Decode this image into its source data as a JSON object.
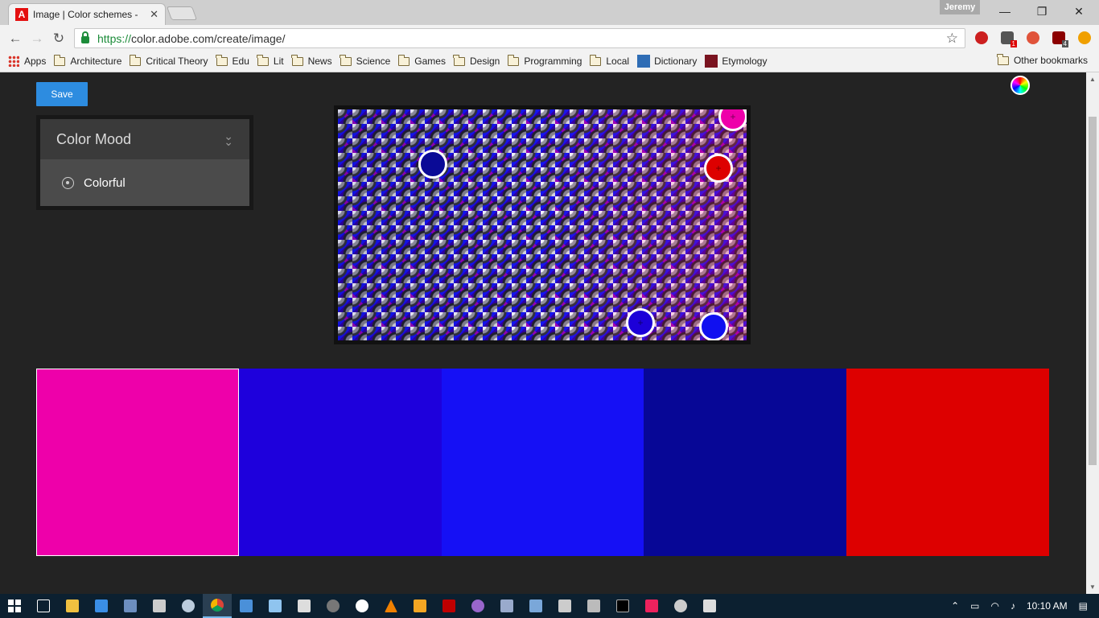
{
  "window": {
    "tab_title": "Image | Color schemes -",
    "tab_close": "✕",
    "profile_name": "Jeremy",
    "controls": {
      "minimize": "—",
      "restore": "❐",
      "close": "✕"
    }
  },
  "toolbar": {
    "back": "←",
    "forward": "→",
    "reload": "↻",
    "url_scheme": "https://",
    "url_rest": "color.adobe.com/create/image/",
    "star": "☆",
    "ext_badges": {
      "ext2": "1",
      "ext4": "4"
    }
  },
  "bookmarks": {
    "apps": "Apps",
    "folders": [
      "Architecture",
      "Critical Theory",
      "Edu",
      "Lit",
      "News",
      "Science",
      "Games",
      "Design",
      "Programming",
      "Local"
    ],
    "dictionary": "Dictionary",
    "etymology": "Etymology",
    "other": "Other bookmarks"
  },
  "page": {
    "save_label": "Save",
    "color_mood": {
      "title": "Color Mood",
      "selected": "Colorful"
    },
    "pickers": [
      {
        "color": "#ee00aa",
        "icon": "+"
      },
      {
        "color": "#0a0a96",
        "icon": ""
      },
      {
        "color": "#dd0000",
        "icon": "+"
      },
      {
        "color": "#1c00d8",
        "icon": "+"
      },
      {
        "color": "#1010f0",
        "icon": ""
      }
    ],
    "swatches": [
      "#ee00aa",
      "#1e00dc",
      "#1510f5",
      "#070796",
      "#dd0000"
    ],
    "active_swatch": 0
  },
  "taskbar": {
    "time": "10:10 AM"
  },
  "colors": {
    "page_bg": "#232323",
    "accent": "#2d8ce0",
    "taskbar": "#0c2030"
  }
}
